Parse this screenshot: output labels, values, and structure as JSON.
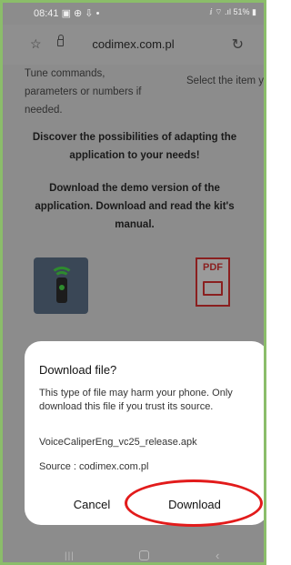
{
  "status_bar": {
    "time_icons": "08:41 ▣ ⊕ ⇩ •",
    "right_icons": "ⅈ ⌔ .ıl 51% ▮"
  },
  "address_bar": {
    "url": "codimex.com.pl",
    "star_icon": "☆",
    "reload_icon": "↻"
  },
  "page": {
    "left_text": "Tune commands, parameters or numbers if needed.",
    "right_text": "Select the item yo to tune.",
    "bold_1": "Discover the possibilities of adapting the application to your needs!",
    "bold_2": "Download the demo version of the application. Download and read the kit's manual.",
    "pdf_label": "PDF"
  },
  "dialog": {
    "title": "Download file?",
    "message": "This type of file may harm your phone. Only download this file if you trust its source.",
    "filename": "VoiceCaliperEng_vc25_release.apk",
    "source": "Source : codimex.com.pl",
    "cancel_label": "Cancel",
    "download_label": "Download",
    "highlight_color": "#e21b1b"
  },
  "nav_bar": {
    "recent_glyph": "|||",
    "back_glyph": "‹"
  }
}
